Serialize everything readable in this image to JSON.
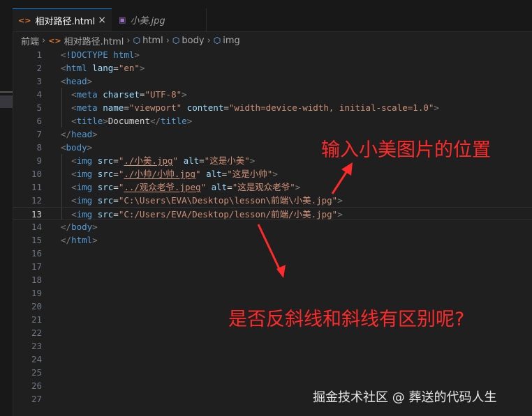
{
  "tabs": [
    {
      "icon": "html-file-icon",
      "glyph": "<>",
      "label": "相对路径.html",
      "close": "×",
      "active": true
    },
    {
      "icon": "image-file-icon",
      "glyph": "▣",
      "label": "小美.jpg",
      "active": false
    }
  ],
  "breadcrumb": {
    "folder": "前端",
    "file": "相对路径.html",
    "html": "html",
    "body": "body",
    "img": "img"
  },
  "code_lines": [
    {
      "n": "1",
      "tokens": [
        [
          "punc",
          "<"
        ],
        [
          "dt",
          "!DOCTYPE "
        ],
        [
          "tag",
          "html"
        ],
        [
          "punc",
          ">"
        ]
      ]
    },
    {
      "n": "2",
      "tokens": [
        [
          "punc",
          "<"
        ],
        [
          "tag",
          "html "
        ],
        [
          "attr",
          "lang"
        ],
        [
          "text",
          "="
        ],
        [
          "str",
          "\"en\""
        ],
        [
          "punc",
          ">"
        ]
      ]
    },
    {
      "n": "3",
      "tokens": [
        [
          "punc",
          "<"
        ],
        [
          "tag",
          "head"
        ],
        [
          "punc",
          ">"
        ]
      ]
    },
    {
      "n": "4",
      "tokens": [
        [
          "text",
          "  "
        ],
        [
          "punc",
          "<"
        ],
        [
          "tag",
          "meta "
        ],
        [
          "attr",
          "charset"
        ],
        [
          "text",
          "="
        ],
        [
          "str",
          "\"UTF-8\""
        ],
        [
          "punc",
          ">"
        ]
      ]
    },
    {
      "n": "5",
      "tokens": [
        [
          "text",
          "  "
        ],
        [
          "punc",
          "<"
        ],
        [
          "tag",
          "meta "
        ],
        [
          "attr",
          "name"
        ],
        [
          "text",
          "="
        ],
        [
          "str",
          "\"viewport\" "
        ],
        [
          "attr",
          "content"
        ],
        [
          "text",
          "="
        ],
        [
          "str",
          "\"width=device-width, initial-scale=1.0\""
        ],
        [
          "punc",
          ">"
        ]
      ]
    },
    {
      "n": "6",
      "tokens": [
        [
          "text",
          "  "
        ],
        [
          "punc",
          "<"
        ],
        [
          "tag",
          "title"
        ],
        [
          "punc",
          ">"
        ],
        [
          "text",
          "Document"
        ],
        [
          "punc",
          "</"
        ],
        [
          "tag",
          "title"
        ],
        [
          "punc",
          ">"
        ]
      ]
    },
    {
      "n": "7",
      "tokens": [
        [
          "punc",
          "</"
        ],
        [
          "tag",
          "head"
        ],
        [
          "punc",
          ">"
        ]
      ]
    },
    {
      "n": "8",
      "tokens": [
        [
          "punc",
          "<"
        ],
        [
          "tag",
          "body"
        ],
        [
          "punc",
          ">"
        ]
      ]
    },
    {
      "n": "9",
      "tokens": [
        [
          "text",
          "  "
        ],
        [
          "punc",
          "<"
        ],
        [
          "tag",
          "img "
        ],
        [
          "attr",
          "src"
        ],
        [
          "text",
          "="
        ],
        [
          "str",
          "\""
        ],
        [
          "stru",
          "./小美.jpg"
        ],
        [
          "str",
          "\" "
        ],
        [
          "attr",
          "alt"
        ],
        [
          "text",
          "="
        ],
        [
          "str",
          "\"这是小美\""
        ],
        [
          "punc",
          ">"
        ]
      ]
    },
    {
      "n": "10",
      "tokens": [
        [
          "text",
          "  "
        ],
        [
          "punc",
          "<"
        ],
        [
          "tag",
          "img "
        ],
        [
          "attr",
          "src"
        ],
        [
          "text",
          "="
        ],
        [
          "str",
          "\""
        ],
        [
          "stru",
          "./小帅/小帅.jpg"
        ],
        [
          "str",
          "\" "
        ],
        [
          "attr",
          "alt"
        ],
        [
          "text",
          "="
        ],
        [
          "str",
          "\"这是小帅\""
        ],
        [
          "punc",
          ">"
        ]
      ]
    },
    {
      "n": "11",
      "tokens": [
        [
          "text",
          "  "
        ],
        [
          "punc",
          "<"
        ],
        [
          "tag",
          "img "
        ],
        [
          "attr",
          "src"
        ],
        [
          "text",
          "="
        ],
        [
          "str",
          "\""
        ],
        [
          "stru",
          "../观众老爷.jpeg"
        ],
        [
          "str",
          "\" "
        ],
        [
          "attr",
          "alt"
        ],
        [
          "text",
          "="
        ],
        [
          "str",
          "\"这是观众老爷\""
        ],
        [
          "punc",
          ">"
        ]
      ]
    },
    {
      "n": "12",
      "tokens": [
        [
          "text",
          "  "
        ],
        [
          "punc",
          "<"
        ],
        [
          "tag",
          "img "
        ],
        [
          "attr",
          "src"
        ],
        [
          "text",
          "="
        ],
        [
          "str",
          "\"C:\\Users\\EVA\\Desktop\\lesson\\前端\\小美.jpg\""
        ],
        [
          "punc",
          ">"
        ]
      ]
    },
    {
      "n": "13",
      "current": true,
      "tokens": [
        [
          "text",
          "  "
        ],
        [
          "punc",
          "<"
        ],
        [
          "tag",
          "img "
        ],
        [
          "attr",
          "src"
        ],
        [
          "text",
          "="
        ],
        [
          "str",
          "\"C:/Users/EVA/Desktop/lesson/前端/小美.jpg\""
        ],
        [
          "punc",
          ">"
        ]
      ]
    },
    {
      "n": "14",
      "tokens": [
        [
          "punc",
          "</"
        ],
        [
          "tag",
          "body"
        ],
        [
          "punc",
          ">"
        ]
      ]
    },
    {
      "n": "15",
      "tokens": [
        [
          "punc",
          "</"
        ],
        [
          "tag",
          "html"
        ],
        [
          "punc",
          ">"
        ]
      ]
    },
    {
      "n": "16",
      "tokens": []
    },
    {
      "n": "17",
      "tokens": []
    },
    {
      "n": "18",
      "tokens": []
    },
    {
      "n": "19",
      "tokens": []
    },
    {
      "n": "20",
      "tokens": []
    },
    {
      "n": "21",
      "tokens": []
    },
    {
      "n": "22",
      "tokens": []
    },
    {
      "n": "23",
      "tokens": []
    },
    {
      "n": "24",
      "tokens": []
    },
    {
      "n": "25",
      "tokens": []
    },
    {
      "n": "26",
      "tokens": []
    },
    {
      "n": "27",
      "tokens": []
    }
  ],
  "annotations": {
    "top": "输入小美图片的位置",
    "bottom": "是否反斜线和斜线有区别呢?"
  },
  "watermark": "掘金技术社区 @ 葬送的代码人生",
  "colors": {
    "accent": "#0078d4",
    "annotation": "#ff2a2a",
    "tag": "#569cd6",
    "attribute": "#9cdcfe",
    "string": "#ce9178"
  }
}
